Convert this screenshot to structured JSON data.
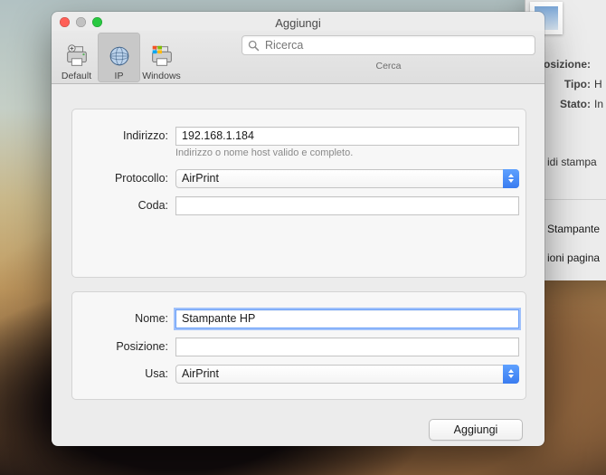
{
  "window": {
    "title": "Aggiungi"
  },
  "toolbar": {
    "default_label": "Default",
    "ip_label": "IP",
    "windows_label": "Windows",
    "search_placeholder": "Ricerca",
    "search_caption": "Cerca"
  },
  "form": {
    "address_label": "Indirizzo:",
    "address_value": "192.168.1.184",
    "address_hint": "Indirizzo o nome host valido e completo.",
    "protocol_label": "Protocollo:",
    "protocol_value": "AirPrint",
    "queue_label": "Coda:",
    "queue_value": "",
    "name_label": "Nome:",
    "name_value": "Stampante HP",
    "location_label": "Posizione:",
    "location_value": "",
    "use_label": "Usa:",
    "use_value": "AirPrint"
  },
  "buttons": {
    "add": "Aggiungi"
  },
  "background_window": {
    "position_label": "osizione:",
    "type_label": "Tipo:",
    "type_value": "H",
    "state_label": "Stato:",
    "state_value": "In",
    "share_btn": "idi stampa",
    "printer_link": "Stampante",
    "page_link": "ioni pagina"
  }
}
